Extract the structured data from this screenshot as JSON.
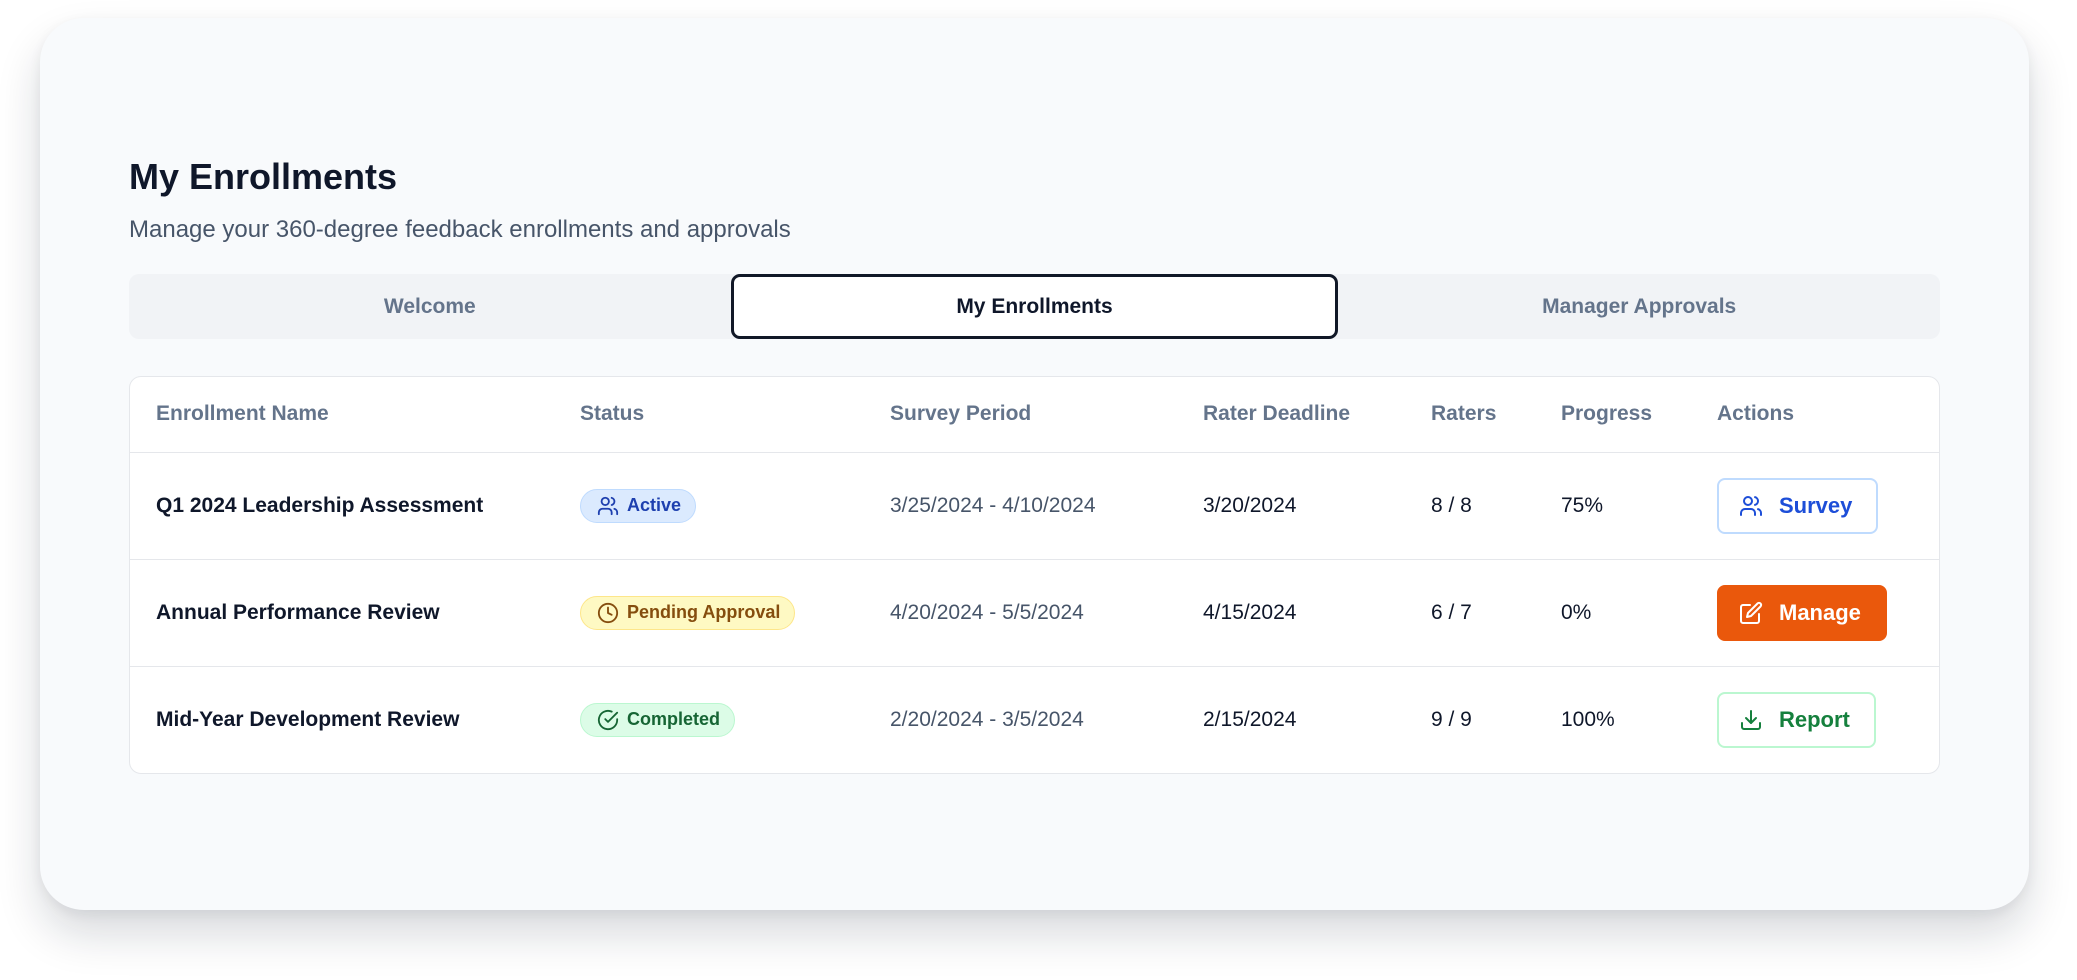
{
  "header": {
    "title": "My Enrollments",
    "subtitle": "Manage your 360-degree feedback enrollments and approvals"
  },
  "tabs": [
    {
      "label": "Welcome",
      "active": false
    },
    {
      "label": "My Enrollments",
      "active": true
    },
    {
      "label": "Manager Approvals",
      "active": false
    }
  ],
  "table": {
    "columns": [
      "Enrollment Name",
      "Status",
      "Survey Period",
      "Rater Deadline",
      "Raters",
      "Progress",
      "Actions"
    ],
    "rows": [
      {
        "name": "Q1 2024 Leadership Assessment",
        "status": "Active",
        "status_icon": "users-icon",
        "survey_period": "3/25/2024 - 4/10/2024",
        "rater_deadline": "3/20/2024",
        "raters": "8 / 8",
        "progress": "75%",
        "action": "Survey",
        "action_icon": "users-icon"
      },
      {
        "name": "Annual Performance Review",
        "status": "Pending Approval",
        "status_icon": "clock-icon",
        "survey_period": "4/20/2024 - 5/5/2024",
        "rater_deadline": "4/15/2024",
        "raters": "6 / 7",
        "progress": "0%",
        "action": "Manage",
        "action_icon": "edit-icon"
      },
      {
        "name": "Mid-Year Development Review",
        "status": "Completed",
        "status_icon": "check-circle-icon",
        "survey_period": "2/20/2024 - 3/5/2024",
        "rater_deadline": "2/15/2024",
        "raters": "9 / 9",
        "progress": "100%",
        "action": "Report",
        "action_icon": "download-icon"
      }
    ]
  },
  "colors": {
    "active_badge": "#1e40af",
    "pending_badge": "#854d0e",
    "completed_badge": "#166534",
    "manage_button": "#ea580c",
    "survey_button": "#1d4ed8",
    "report_button": "#15803d"
  }
}
